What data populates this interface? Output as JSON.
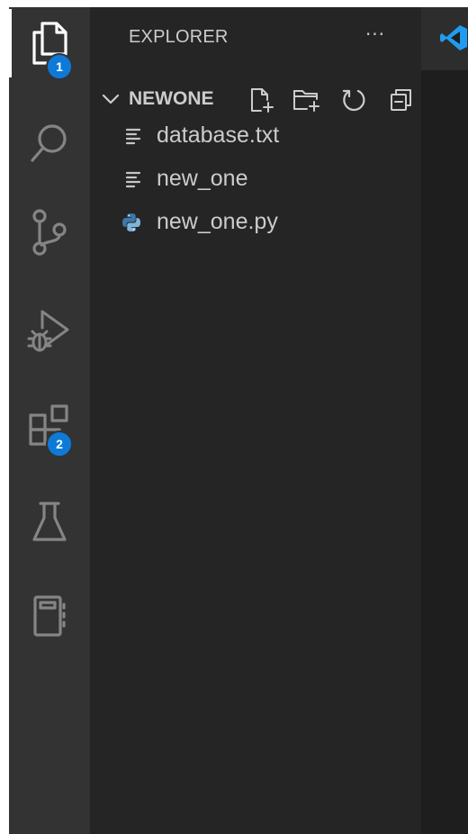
{
  "activity_bar": {
    "items": [
      {
        "name": "explorer",
        "icon": "files-icon",
        "badge": "1",
        "active": true
      },
      {
        "name": "search",
        "icon": "search-icon"
      },
      {
        "name": "source-control",
        "icon": "source-control-icon"
      },
      {
        "name": "run-and-debug",
        "icon": "run-debug-icon"
      },
      {
        "name": "extensions",
        "icon": "extensions-icon",
        "badge": "2"
      },
      {
        "name": "testing",
        "icon": "flask-icon"
      },
      {
        "name": "notebook",
        "icon": "notebook-icon"
      }
    ],
    "badge_color": "#0e7ad8"
  },
  "sidebar": {
    "title": "EXPLORER",
    "more": "···",
    "section": {
      "title": "NEWONE",
      "actions": [
        "new-file-icon",
        "new-folder-icon",
        "refresh-icon",
        "collapse-all-icon"
      ]
    },
    "files": [
      {
        "label": "database.txt",
        "icon": "text-file-icon"
      },
      {
        "label": "new_one",
        "icon": "text-file-icon"
      },
      {
        "label": "new_one.py",
        "icon": "python-icon"
      }
    ]
  },
  "editor": {
    "tab_icon": "vscode-logo-icon"
  },
  "colors": {
    "activity_bg": "#333333",
    "sidebar_bg": "#252526",
    "editor_bg": "#1e1e1e",
    "text": "#cccccc",
    "icon": "#c5c5c5",
    "accent": "#0e7ad8"
  }
}
